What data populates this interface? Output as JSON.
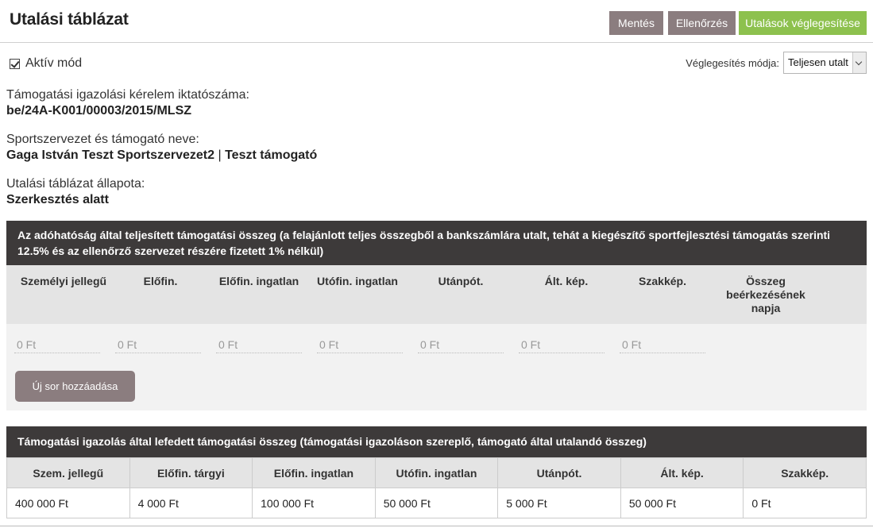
{
  "header": {
    "title": "Utalási táblázat",
    "buttons": {
      "save": "Mentés",
      "check": "Ellenőrzés",
      "finalize": "Utalások véglegesítése"
    }
  },
  "active_mode": {
    "label": "Aktív mód",
    "checked": true
  },
  "finalize_mode": {
    "label": "Véglegesítés módja:",
    "selected": "Teljesen utalt"
  },
  "info": {
    "registration_label": "Támogatási igazolási kérelem iktatószáma:",
    "registration_value": "be/24A-K001/00003/2015/MLSZ",
    "names_label": "Sportszervezet és támogató neve:",
    "org_name": "Gaga István Teszt Sportszervezet2",
    "separator": "|",
    "supporter_name": "Teszt támogató",
    "status_label": "Utalási táblázat állapota:",
    "status_value": "Szerkesztés alatt"
  },
  "section1": {
    "title": "Az adóhatóság által teljesített támogatási összeg (a felajánlott teljes összegből a bankszámlára utalt, tehát a kiegészítő sportfejlesztési támogatás szerinti 12.5% és az ellenőrző szervezet részére fizetett 1% nélkül)",
    "columns": [
      "Személyi jellegű",
      "Előfin.",
      "Előfin. ingatlan",
      "Utófin. ingatlan",
      "Utánpót.",
      "Ált. kép.",
      "Szakkép.",
      "Összeg beérkezésének napja"
    ],
    "input_placeholders": [
      "0 Ft",
      "0 Ft",
      "0 Ft",
      "0 Ft",
      "0 Ft",
      "0 Ft",
      "0 Ft"
    ],
    "add_row_label": "Új sor hozzáadása"
  },
  "section2": {
    "title": "Támogatási igazolás által lefedett támogatási összeg (támogatási igazoláson szereplő, támogató által utalandó összeg)",
    "columns": [
      "Szem. jellegű",
      "Előfin. tárgyi",
      "Előfin. ingatlan",
      "Utófin. ingatlan",
      "Utánpót.",
      "Ált. kép.",
      "Szakkép."
    ],
    "values": [
      "400 000 Ft",
      "4 000 Ft",
      "100 000 Ft",
      "50 000 Ft",
      "5 000 Ft",
      "50 000 Ft",
      "0 Ft"
    ]
  }
}
